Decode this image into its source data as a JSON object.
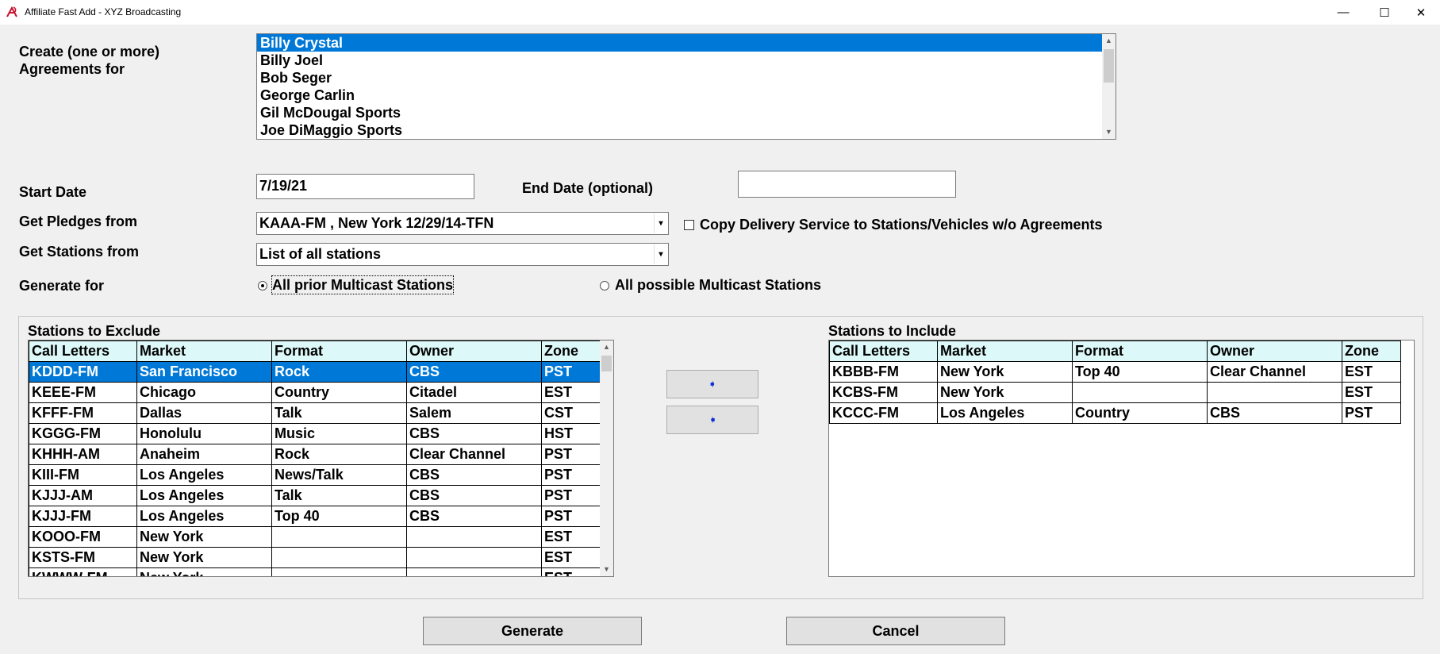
{
  "window": {
    "title": "Affiliate Fast Add - XYZ Broadcasting",
    "minimize": "—",
    "maximize": "☐",
    "close": "✕"
  },
  "labels": {
    "create_line1": "Create (one or more)",
    "create_line2": "Agreements for",
    "start_date": "Start Date",
    "end_date": "End Date (optional)",
    "get_pledges": "Get Pledges from",
    "get_stations": "Get Stations from",
    "generate_for": "Generate for",
    "copy_delivery": "Copy Delivery Service to Stations/Vehicles w/o Agreements"
  },
  "agreements_list": [
    "Billy Crystal",
    "Billy Joel",
    "Bob Seger",
    "George Carlin",
    "Gil McDougal Sports",
    "Joe DiMaggio Sports"
  ],
  "start_date_value": "7/19/21",
  "end_date_value": "",
  "pledges_value": "KAAA-FM , New York 12/29/14-TFN",
  "stations_value": "List of all stations",
  "radio_options": {
    "prior": "All prior Multicast Stations",
    "possible": "All possible Multicast Stations"
  },
  "exclude": {
    "title": "Stations to Exclude",
    "columns": [
      "Call Letters",
      "Market",
      "Format",
      "Owner",
      "Zone"
    ],
    "rows": [
      [
        "KDDD-FM",
        "San Francisco",
        "Rock",
        "CBS",
        "PST"
      ],
      [
        "KEEE-FM",
        "Chicago",
        "Country",
        "Citadel",
        "EST"
      ],
      [
        "KFFF-FM",
        "Dallas",
        "Talk",
        "Salem",
        "CST"
      ],
      [
        "KGGG-FM",
        "Honolulu",
        "Music",
        "CBS",
        "HST"
      ],
      [
        "KHHH-AM",
        "Anaheim",
        "Rock",
        "Clear Channel",
        "PST"
      ],
      [
        "KIII-FM",
        "Los Angeles",
        "News/Talk",
        "CBS",
        "PST"
      ],
      [
        "KJJJ-AM",
        "Los Angeles",
        "Talk",
        "CBS",
        "PST"
      ],
      [
        "KJJJ-FM",
        "Los Angeles",
        "Top 40",
        "CBS",
        "PST"
      ],
      [
        "KOOO-FM",
        "New York",
        "",
        "",
        "EST"
      ],
      [
        "KSTS-FM",
        "New York",
        "",
        "",
        "EST"
      ],
      [
        "KWWW-FM",
        "New York",
        "",
        "",
        "EST"
      ]
    ]
  },
  "include": {
    "title": "Stations to Include",
    "columns": [
      "Call Letters",
      "Market",
      "Format",
      "Owner",
      "Zone"
    ],
    "rows": [
      [
        "KBBB-FM",
        "New York",
        "Top 40",
        "Clear Channel",
        "EST"
      ],
      [
        "KCBS-FM",
        "New York",
        "",
        "",
        "EST"
      ],
      [
        "KCCC-FM",
        "Los Angeles",
        "Country",
        "CBS",
        "PST"
      ]
    ]
  },
  "buttons": {
    "generate": "Generate",
    "cancel": "Cancel"
  },
  "colors": {
    "selection": "#0078d7",
    "grid_header": "#ddf8f8",
    "arrow": "#0a2dd8"
  }
}
